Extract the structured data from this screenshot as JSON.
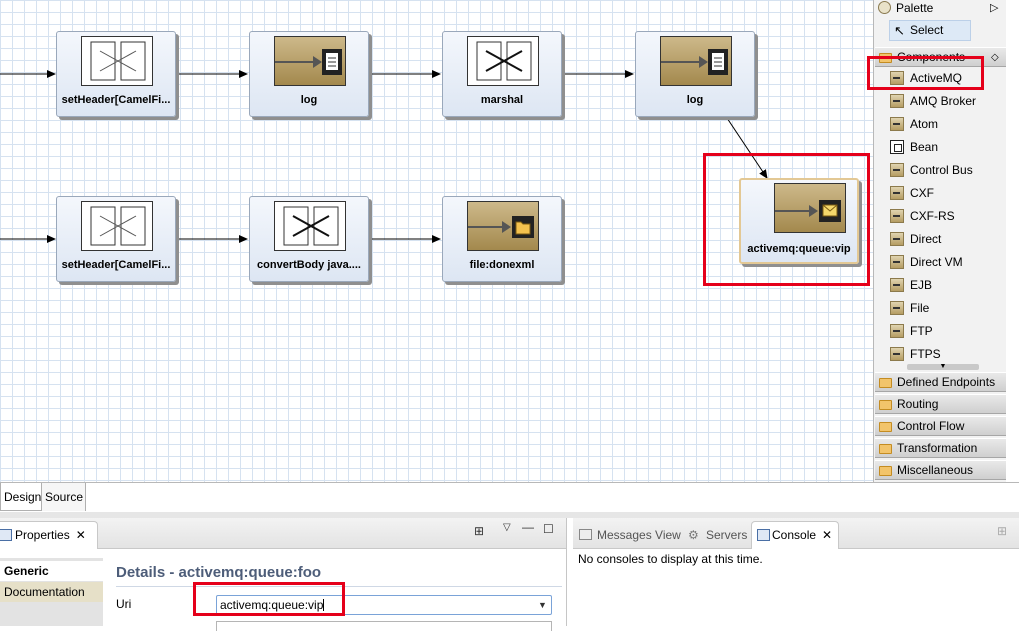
{
  "canvas": {
    "nodes": [
      {
        "label": "setHeader[CamelFi...",
        "kind": "transform"
      },
      {
        "label": "log",
        "kind": "endpoint-doc"
      },
      {
        "label": "marshal",
        "kind": "transform"
      },
      {
        "label": "log",
        "kind": "endpoint-doc"
      },
      {
        "label": "activemq:queue:vip",
        "kind": "endpoint-mail"
      },
      {
        "label": "setHeader[CamelFi...",
        "kind": "transform"
      },
      {
        "label": "convertBody java....",
        "kind": "transform"
      },
      {
        "label": "file:donexml",
        "kind": "endpoint-folder"
      }
    ]
  },
  "palette": {
    "title": "Palette",
    "select_label": "Select",
    "components_label": "Components",
    "items": [
      "ActiveMQ",
      "AMQ Broker",
      "Atom",
      "Bean",
      "Control Bus",
      "CXF",
      "CXF-RS",
      "Direct",
      "Direct VM",
      "EJB",
      "File",
      "FTP",
      "FTPS"
    ],
    "drawers": [
      "Defined Endpoints",
      "Routing",
      "Control Flow",
      "Transformation",
      "Miscellaneous"
    ]
  },
  "editor_tabs": [
    "Design",
    "Source"
  ],
  "properties": {
    "tab_label": "Properties",
    "side_tabs": [
      "Generic",
      "Documentation"
    ],
    "details_title": "Details - activemq:queue:foo",
    "uri_label": "Uri",
    "uri_value": "activemq:queue:vip"
  },
  "console": {
    "tabs": [
      "Messages View",
      "Servers",
      "Console"
    ],
    "message": "No consoles to display at this time."
  },
  "colors": {
    "highlight": "#e5001a",
    "grid": "#d6e2f0",
    "details_title": "#4d5d79"
  }
}
